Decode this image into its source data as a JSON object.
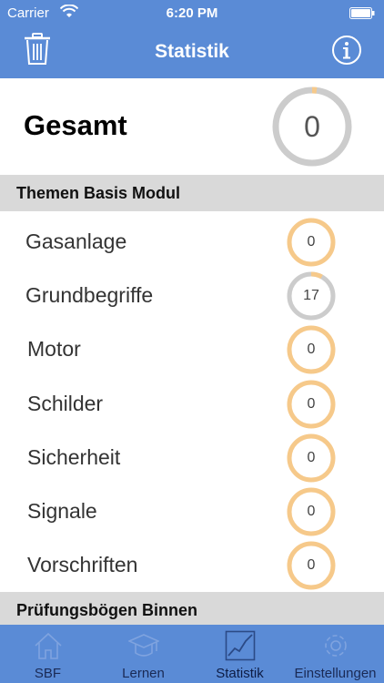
{
  "status_bar": {
    "carrier": "Carrier",
    "time": "6:20 PM"
  },
  "nav": {
    "title": "Statistik",
    "left_icon": "trash-icon",
    "right_icon": "info-icon"
  },
  "overall": {
    "label": "Gesamt",
    "value": "0",
    "progress": 0.02
  },
  "sections": [
    {
      "title": "Themen Basis Modul",
      "topics": [
        {
          "label": "Gasanlage",
          "value": "0",
          "progress": 0.0
        },
        {
          "label": "Grundbegriffe",
          "value": "17",
          "progress": 0.08
        },
        {
          "label": "Motor",
          "value": "0",
          "progress": 0.0
        },
        {
          "label": "Schilder",
          "value": "0",
          "progress": 0.0
        },
        {
          "label": "Sicherheit",
          "value": "0",
          "progress": 0.0
        },
        {
          "label": "Signale",
          "value": "0",
          "progress": 0.0
        },
        {
          "label": "Vorschriften",
          "value": "0",
          "progress": 0.0
        }
      ]
    },
    {
      "title": "Prüfungsbögen Binnen",
      "topics": []
    }
  ],
  "tabs": [
    {
      "label": "SBF",
      "icon": "home-icon",
      "active": false
    },
    {
      "label": "Lernen",
      "icon": "graduation-cap-icon",
      "active": false
    },
    {
      "label": "Statistik",
      "icon": "chart-icon",
      "active": true
    },
    {
      "label": "Einstellungen",
      "icon": "gear-icon",
      "active": false
    }
  ],
  "colors": {
    "primary": "#5a8bd6",
    "ring_orange": "#f6c98a",
    "ring_gray": "#cccccc",
    "section_bg": "#d9d9d9"
  }
}
